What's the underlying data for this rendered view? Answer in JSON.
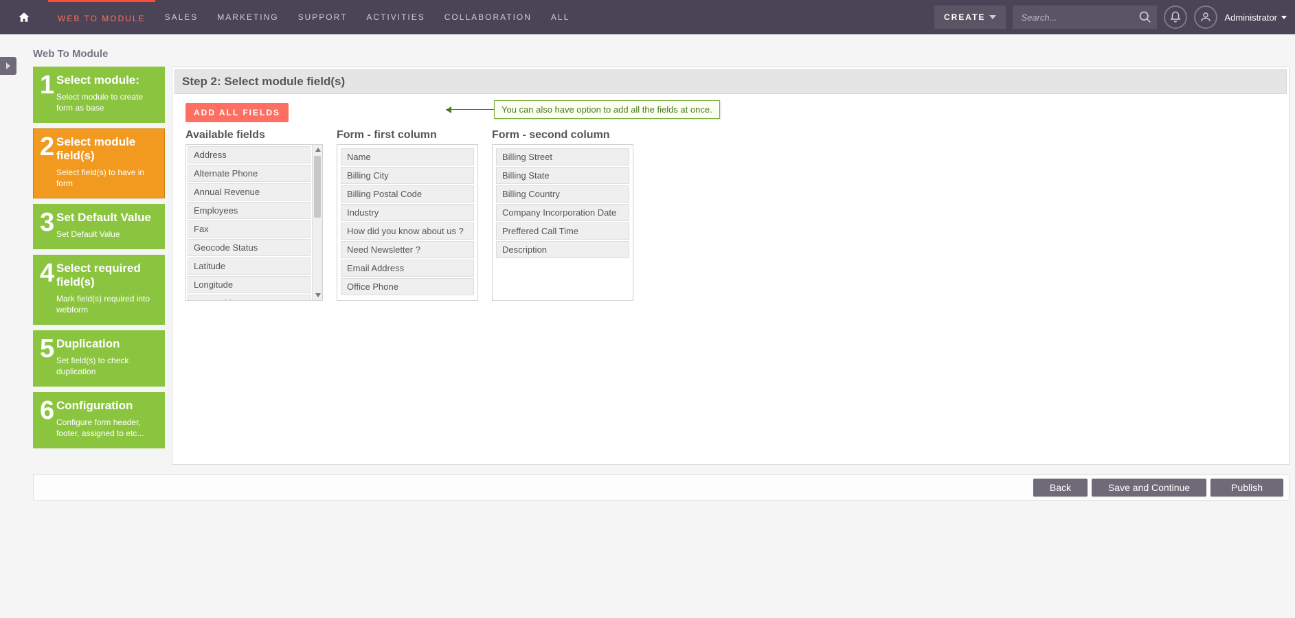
{
  "nav": {
    "items": [
      {
        "label": "WEB TO MODULE",
        "active": true
      },
      {
        "label": "SALES"
      },
      {
        "label": "MARKETING"
      },
      {
        "label": "SUPPORT"
      },
      {
        "label": "ACTIVITIES"
      },
      {
        "label": "COLLABORATION"
      },
      {
        "label": "ALL"
      }
    ],
    "create_label": "CREATE",
    "search_placeholder": "Search...",
    "user_label": "Administrator"
  },
  "breadcrumb": "Web To Module",
  "side_panel_open": false,
  "steps": [
    {
      "num": "1",
      "title": "Select module:",
      "desc": "Select module to create form as base"
    },
    {
      "num": "2",
      "title": "Select module field(s)",
      "desc": "Select field(s) to have in form",
      "active": true
    },
    {
      "num": "3",
      "title": "Set Default Value",
      "desc": "Set Default Value"
    },
    {
      "num": "4",
      "title": "Select required field(s)",
      "desc": "Mark field(s) required into webform"
    },
    {
      "num": "5",
      "title": "Duplication",
      "desc": "Set field(s) to check duplication"
    },
    {
      "num": "6",
      "title": "Configuration",
      "desc": "Configure form header, footer, assigned to etc..."
    }
  ],
  "content": {
    "header": "Step 2: Select module field(s)",
    "add_all_label": "ADD ALL FIELDS",
    "callout_text": "You can also have option to add all the fields at once.",
    "columns": {
      "available": {
        "title": "Available fields",
        "items": [
          "Address",
          "Alternate Phone",
          "Annual Revenue",
          "Employees",
          "Fax",
          "Geocode Status",
          "Latitude",
          "Longitude",
          "Ownership"
        ]
      },
      "first": {
        "title": "Form - first column",
        "items": [
          "Name",
          "Billing City",
          "Billing Postal Code",
          "Industry",
          "How did you know about us ?",
          "Need Newsletter ?",
          "Email Address",
          "Office Phone"
        ]
      },
      "second": {
        "title": "Form - second column",
        "items": [
          "Billing Street",
          "Billing State",
          "Billing Country",
          "Company Incorporation Date",
          "Preffered Call Time",
          "Description"
        ]
      }
    }
  },
  "footer": {
    "back": "Back",
    "save": "Save and Continue",
    "publish": "Publish"
  }
}
